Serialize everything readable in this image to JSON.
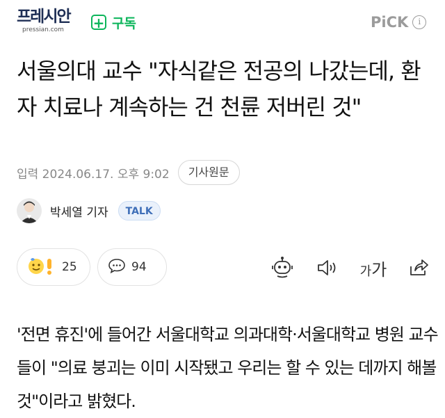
{
  "header": {
    "logo": "프레시안",
    "logo_url": "pressian.com",
    "subscribe_label": "구독",
    "pick_label": "PiCK"
  },
  "article": {
    "title": "서울의대 교수 \"자식같은 전공의 나갔는데, 환자 치료나 계속하는 건 천륜 저버린 것\"",
    "date": "입력 2024.06.17. 오후 9:02",
    "original_button": "기사원문",
    "reporter": "박세열 기자",
    "talk_label": "TALK",
    "body": "'전면 휴진'에 들어간 서울대학교 의과대학·서울대학교 병원 교수들이 \"의료 붕괴는 이미 시작됐고 우리는 할 수 있는 데까지 해볼 것\"이라고 밝혔다."
  },
  "actions": {
    "reaction_count": "25",
    "comment_count": "94",
    "font_small": "가",
    "font_big": "가"
  },
  "colors": {
    "accent_green": "#0bb55a",
    "logo_navy": "#1f2f55",
    "pick_gray": "#9b9b9b"
  },
  "icons": [
    "plus-icon",
    "info-icon",
    "reaction-emoji-icon",
    "comment-icon",
    "robot-summary-icon",
    "speaker-icon",
    "font-size-icon",
    "share-icon"
  ]
}
